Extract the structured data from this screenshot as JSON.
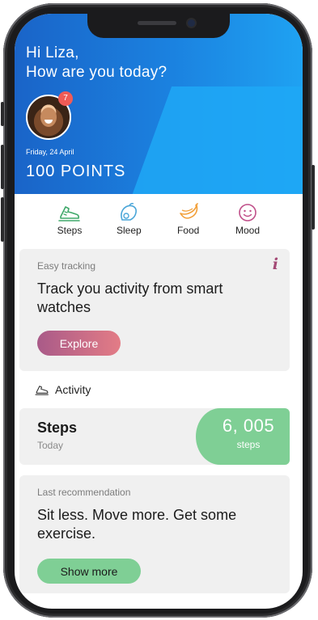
{
  "header": {
    "greeting_line1": "Hi Liza,",
    "greeting_line2": "How are you today?",
    "badge_count": "7",
    "date": "Friday, 24 April",
    "points": "100 POINTS"
  },
  "categories": [
    {
      "label": "Steps",
      "icon": "shoe-icon",
      "color": "#3fa86a"
    },
    {
      "label": "Sleep",
      "icon": "baby-icon",
      "color": "#4aa6d8"
    },
    {
      "label": "Food",
      "icon": "banana-icon",
      "color": "#f2a03a"
    },
    {
      "label": "Mood",
      "icon": "smiley-icon",
      "color": "#c0508a"
    }
  ],
  "tracking_card": {
    "kicker": "Easy tracking",
    "info_icon": "i",
    "title": "Track you activity from smart watches",
    "button_label": "Explore"
  },
  "activity": {
    "heading": "Activity",
    "steps_title": "Steps",
    "steps_sub": "Today",
    "steps_value": "6, 005",
    "steps_unit": "steps"
  },
  "recommendation": {
    "kicker": "Last recommendation",
    "title": "Sit less. Move more. Get some exercise.",
    "button_label": "Show more"
  },
  "colors": {
    "header_blue": "#1b82e0",
    "accent_pink": "#a95a88",
    "accent_green": "#7fcf95",
    "badge_red": "#f05b56"
  }
}
